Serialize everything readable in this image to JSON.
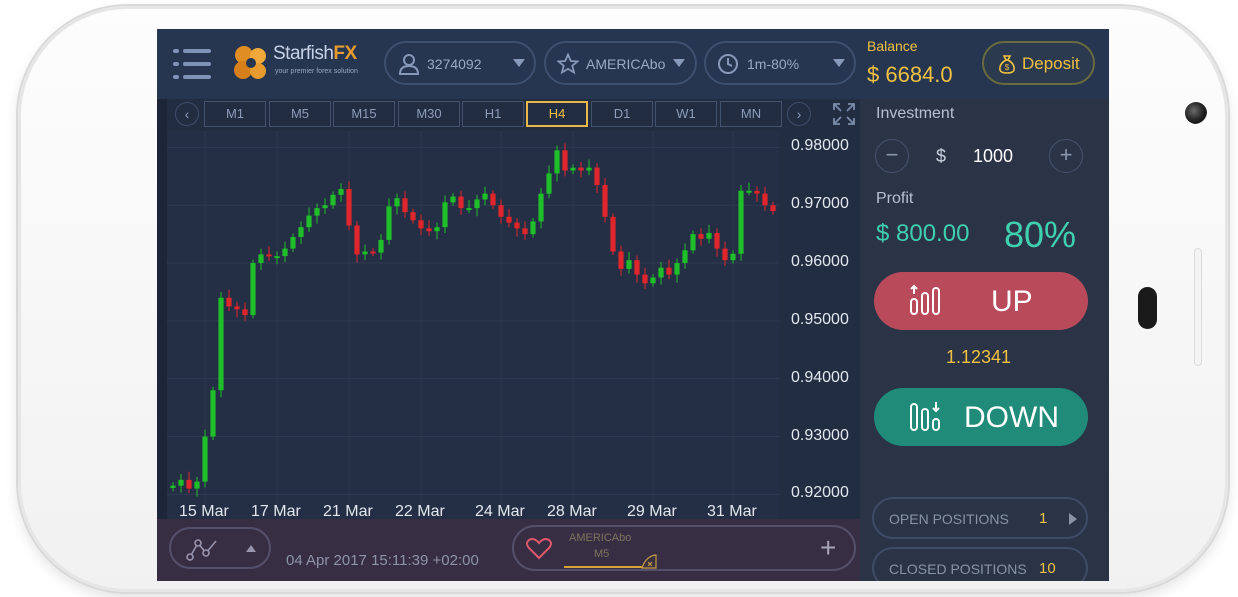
{
  "header": {
    "brand": {
      "name_a": "Starfish",
      "name_b": "FX",
      "tagline": "your premier forex solution"
    },
    "account_id": "3274092",
    "asset": "AMERICAbo",
    "expiry": "1m-80%",
    "balance_label": "Balance",
    "balance_value": "$ 6684.0",
    "deposit_label": "Deposit",
    "icons": {
      "menu": "hamburger-menu-icon",
      "account": "user-icon",
      "favorite": "star-icon",
      "time": "clock-icon",
      "deposit": "money-bag-icon"
    }
  },
  "timeframes": {
    "prev": "‹",
    "next": "›",
    "items": [
      "M1",
      "M5",
      "M15",
      "M30",
      "H1",
      "H4",
      "D1",
      "W1",
      "MN"
    ],
    "active": "H4"
  },
  "chart_data": {
    "type": "candlestick",
    "y_ticks": [
      "0.98000",
      "0.97000",
      "0.96000",
      "0.95000",
      "0.94000",
      "0.93000",
      "0.92000"
    ],
    "x_ticks": [
      "15 Mar",
      "17 Mar",
      "21 Mar",
      "22 Mar",
      "24 Mar",
      "28 Mar",
      "29 Mar",
      "31 Mar"
    ],
    "ylim": [
      0.9185,
      0.9818
    ],
    "up_color": "#1fbf2a",
    "down_color": "#e0262b",
    "candles_close": [
      0.9215,
      0.9225,
      0.921,
      0.9222,
      0.93,
      0.938,
      0.954,
      0.9525,
      0.952,
      0.951,
      0.96,
      0.9615,
      0.9612,
      0.9612,
      0.9625,
      0.9645,
      0.9662,
      0.9682,
      0.9695,
      0.97,
      0.9718,
      0.9728,
      0.9665,
      0.9615,
      0.962,
      0.9618,
      0.964,
      0.9698,
      0.9712,
      0.9688,
      0.9674,
      0.966,
      0.9655,
      0.9662,
      0.9705,
      0.9715,
      0.9695,
      0.9695,
      0.971,
      0.972,
      0.97,
      0.968,
      0.967,
      0.966,
      0.965,
      0.9672,
      0.972,
      0.9755,
      0.9795,
      0.976,
      0.9765,
      0.976,
      0.9765,
      0.9735,
      0.968,
      0.962,
      0.959,
      0.9605,
      0.958,
      0.9565,
      0.9575,
      0.9592,
      0.958,
      0.96,
      0.9622,
      0.965,
      0.9642,
      0.9652,
      0.9625,
      0.9605,
      0.9616,
      0.9725,
      0.9725,
      0.972,
      0.97,
      0.969
    ]
  },
  "bottom": {
    "datetime": "04 Apr 2017 15:11:39 +02:00",
    "asset": "AMERICAbo",
    "asset_timeframe": "M5",
    "add": "+",
    "icons": {
      "indicators": "indicators-icon",
      "favorite": "heart-icon",
      "add": "plus-icon"
    }
  },
  "panel": {
    "investment_label": "Investment",
    "minus": "−",
    "plus": "+",
    "currency": "$",
    "amount": "1000",
    "profit_label": "Profit",
    "profit_value": "$ 800.00",
    "profit_percent": "80%",
    "up_label": "UP",
    "current_price": "1.12341",
    "down_label": "DOWN",
    "open_positions_label": "OPEN POSITIONS",
    "open_positions_count": "1",
    "closed_positions_label": "CLOSED POSITIONS",
    "closed_positions_count": "10",
    "icons": {
      "up": "chart-up-icon",
      "down": "chart-down-icon"
    },
    "colors": {
      "up": "#b84a5a",
      "down": "#1f8b78",
      "accent": "#f0c040",
      "profit": "#3fd0b0"
    }
  }
}
